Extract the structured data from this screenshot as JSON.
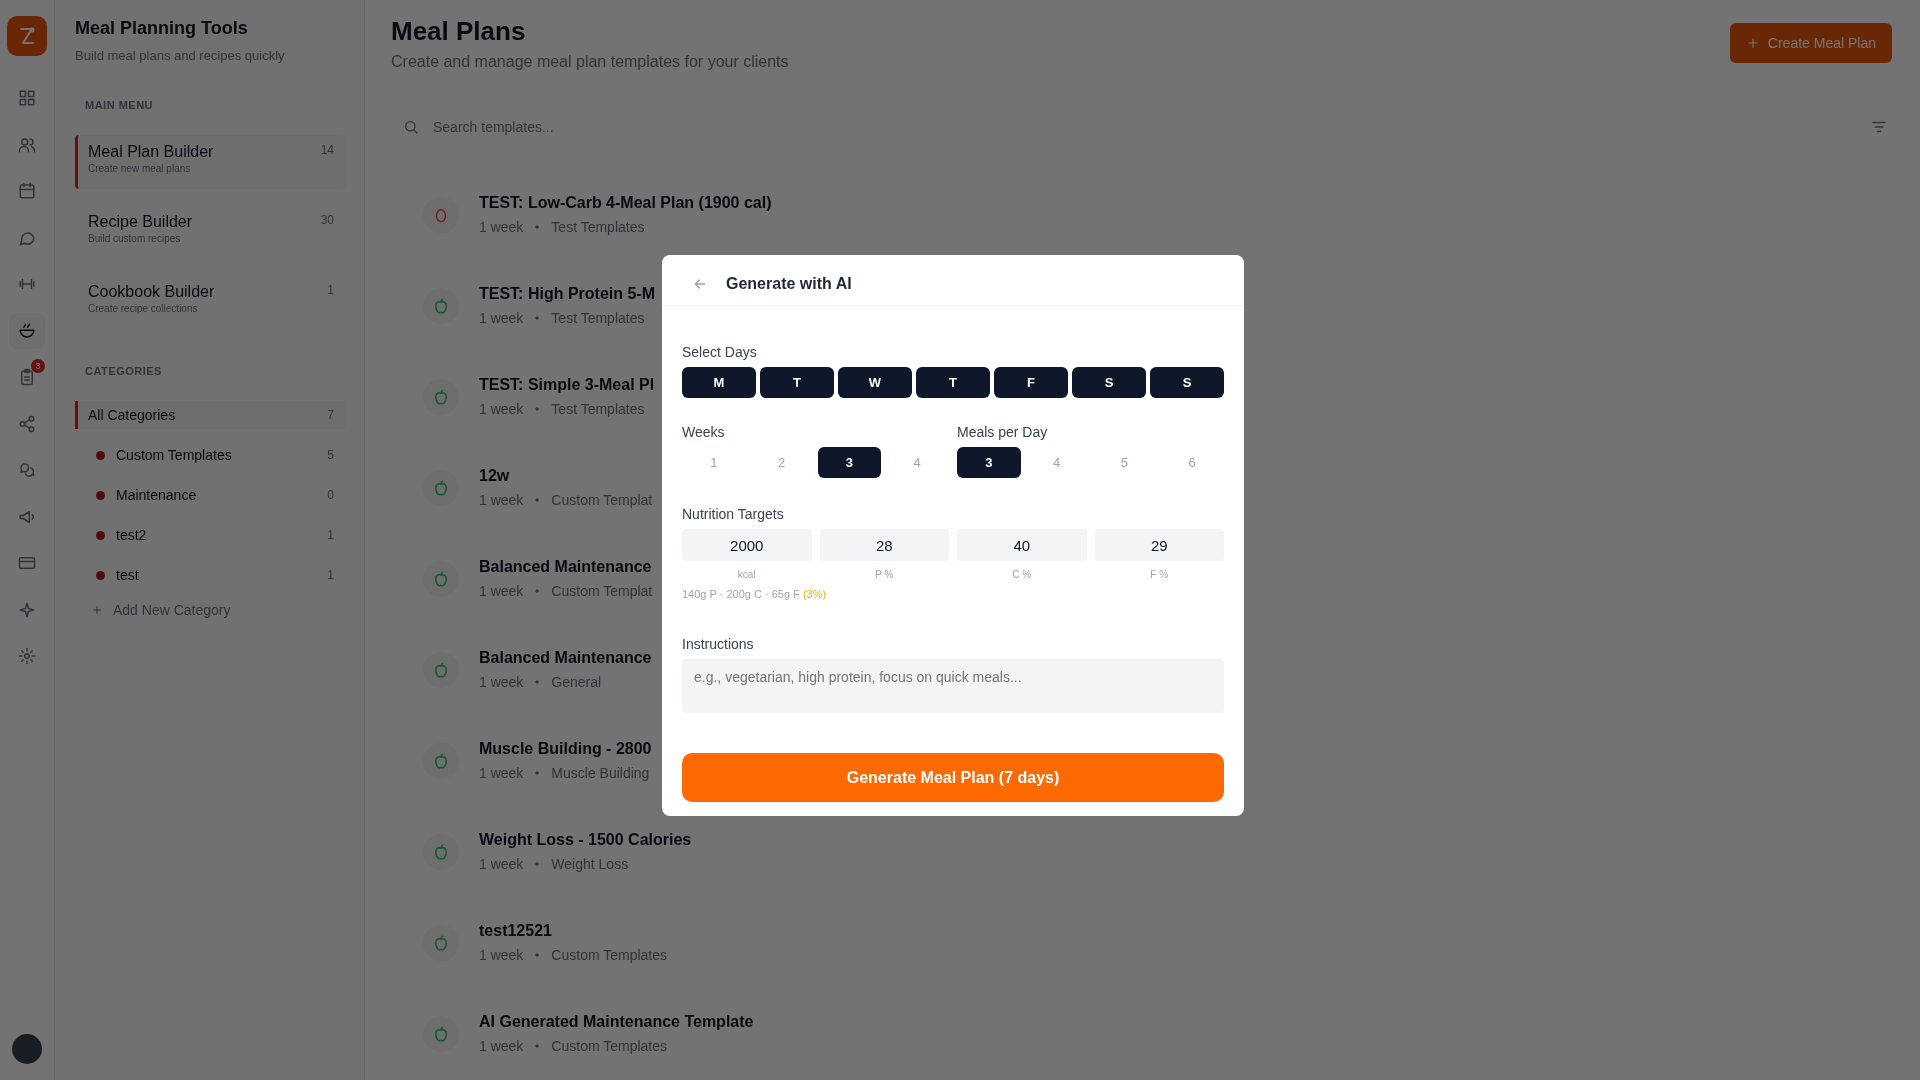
{
  "rail": {
    "items": [
      {
        "kind": "grid",
        "selected": false
      },
      {
        "kind": "users",
        "selected": false
      },
      {
        "kind": "calendar",
        "selected": false
      },
      {
        "kind": "chat",
        "selected": false
      },
      {
        "kind": "dumbbell",
        "selected": false
      },
      {
        "kind": "bowl",
        "selected": true
      },
      {
        "kind": "clipboard",
        "selected": false,
        "badge": "3"
      },
      {
        "kind": "share",
        "selected": false
      },
      {
        "kind": "bubbles",
        "selected": false
      },
      {
        "kind": "megaphone",
        "selected": false
      },
      {
        "kind": "card",
        "selected": false
      },
      {
        "kind": "sparkle",
        "selected": false
      },
      {
        "kind": "gear",
        "selected": false
      }
    ]
  },
  "sidebar": {
    "title": "Meal Planning Tools",
    "subtitle": "Build meal plans and recipes quickly",
    "main_menu_heading": "MAIN MENU",
    "menu": [
      {
        "label": "Meal Plan Builder",
        "description": "Create new meal plans",
        "count": "14",
        "selected": true
      },
      {
        "label": "Recipe Builder",
        "description": "Build custom recipes",
        "count": "30",
        "selected": false
      },
      {
        "label": "Cookbook Builder",
        "description": "Create recipe collections",
        "count": "1",
        "selected": false
      }
    ],
    "categories_heading": "CATEGORIES",
    "categories": [
      {
        "kind": "all",
        "label": "All Categories",
        "count": "7",
        "selected": true
      },
      {
        "kind": "category",
        "label": "Custom Templates",
        "count": "5",
        "selected": false
      },
      {
        "kind": "category",
        "label": "Maintenance",
        "count": "0",
        "selected": false
      },
      {
        "kind": "category",
        "label": "test2",
        "count": "1",
        "selected": false
      },
      {
        "kind": "category",
        "label": "test",
        "count": "1",
        "selected": false
      }
    ],
    "add_category": "Add New Category"
  },
  "header": {
    "title": "Meal Plans",
    "subtitle": "Create and manage meal plan templates for your clients",
    "create_button": "Create Meal Plan"
  },
  "search": {
    "placeholder": "Search templates..."
  },
  "templates": [
    {
      "title": "TEST: Low-Carb 4-Meal Plan (1900 cal)",
      "duration": "1 week",
      "category": "Test Templates",
      "kind": "egg"
    },
    {
      "title": "TEST: High Protein 5-M",
      "duration": "1 week",
      "category": "Test Templates",
      "kind": "apple"
    },
    {
      "title": "TEST: Simple 3-Meal Pl",
      "duration": "1 week",
      "category": "Test Templates",
      "kind": "apple"
    },
    {
      "title": "12w",
      "duration": "1 week",
      "category": "Custom Templat",
      "kind": "apple"
    },
    {
      "title": "Balanced Maintenance",
      "duration": "1 week",
      "category": "Custom Templat",
      "kind": "apple"
    },
    {
      "title": "Balanced Maintenance",
      "duration": "1 week",
      "category": "General",
      "kind": "apple"
    },
    {
      "title": "Muscle Building - 2800",
      "duration": "1 week",
      "category": "Muscle Building",
      "kind": "apple"
    },
    {
      "title": "Weight Loss - 1500 Calories",
      "duration": "1 week",
      "category": "Weight Loss",
      "kind": "apple"
    },
    {
      "title": "test12521",
      "duration": "1 week",
      "category": "Custom Templates",
      "kind": "apple"
    },
    {
      "title": "AI Generated Maintenance Template",
      "duration": "1 week",
      "category": "Custom Templates",
      "kind": "apple"
    }
  ],
  "modal": {
    "title": "Generate with AI",
    "days_label": "Select Days",
    "days": [
      {
        "label": "M",
        "selected": true
      },
      {
        "label": "T",
        "selected": true
      },
      {
        "label": "W",
        "selected": true
      },
      {
        "label": "T",
        "selected": true
      },
      {
        "label": "F",
        "selected": true
      },
      {
        "label": "S",
        "selected": true
      },
      {
        "label": "S",
        "selected": true
      }
    ],
    "weeks_label": "Weeks",
    "weeks": [
      {
        "label": "1",
        "selected": false
      },
      {
        "label": "2",
        "selected": false
      },
      {
        "label": "3",
        "selected": true
      },
      {
        "label": "4",
        "selected": false
      }
    ],
    "meals_label": "Meals per Day",
    "meals": [
      {
        "label": "3",
        "selected": true
      },
      {
        "label": "4",
        "selected": false
      },
      {
        "label": "5",
        "selected": false
      },
      {
        "label": "6",
        "selected": false
      }
    ],
    "nutrition_label": "Nutrition Targets",
    "targets": [
      {
        "value": "2000",
        "unit": "kcal"
      },
      {
        "value": "28",
        "unit": "P %"
      },
      {
        "value": "40",
        "unit": "C %"
      },
      {
        "value": "29",
        "unit": "F %"
      }
    ],
    "summary": "140g P · 200g C · 65g F",
    "summary_warning": "(3%)",
    "instructions_label": "Instructions",
    "instructions_placeholder": "e.g., vegetarian, high protein, focus on quick meals...",
    "generate_button": "Generate Meal Plan (7 days)"
  }
}
